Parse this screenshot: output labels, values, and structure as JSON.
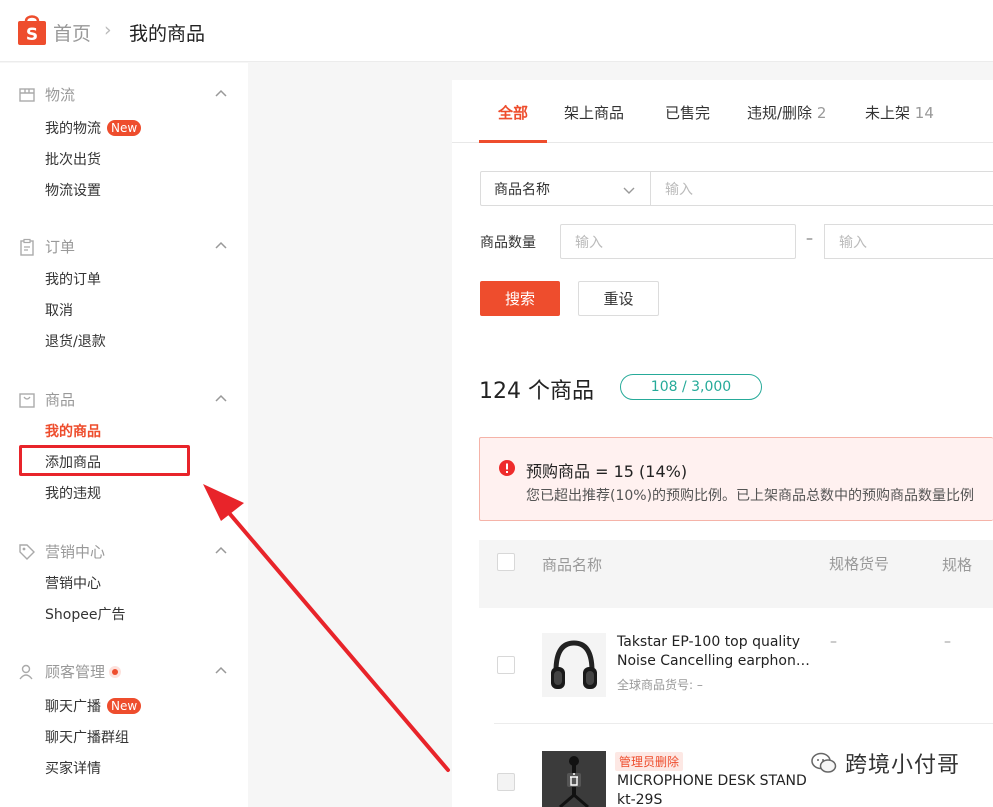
{
  "header": {
    "home": "首页",
    "separator": "›",
    "current": "我的商品"
  },
  "sidebar": {
    "groups": [
      {
        "title": "物流",
        "icon": "box-icon",
        "items": [
          {
            "label": "我的物流",
            "badge": "New"
          },
          {
            "label": "批次出货"
          },
          {
            "label": "物流设置"
          }
        ]
      },
      {
        "title": "订单",
        "icon": "clipboard-icon",
        "items": [
          {
            "label": "我的订单"
          },
          {
            "label": "取消"
          },
          {
            "label": "退货/退款"
          }
        ]
      },
      {
        "title": "商品",
        "icon": "bag-icon",
        "items": [
          {
            "label": "我的商品",
            "active": true
          },
          {
            "label": "添加商品",
            "highlighted": true
          },
          {
            "label": "我的违规"
          }
        ]
      },
      {
        "title": "营销中心",
        "icon": "tag-icon",
        "items": [
          {
            "label": "营销中心"
          },
          {
            "label": "Shopee广告"
          }
        ]
      },
      {
        "title": "顾客管理",
        "icon": "person-icon",
        "dot": true,
        "items": [
          {
            "label": "聊天广播",
            "badge": "New"
          },
          {
            "label": "聊天广播群组"
          },
          {
            "label": "买家详情"
          }
        ]
      }
    ]
  },
  "tabs": [
    {
      "label": "全部",
      "count": "",
      "active": true
    },
    {
      "label": "架上商品",
      "count": ""
    },
    {
      "label": "已售完",
      "count": ""
    },
    {
      "label": "违规/删除",
      "count": "2"
    },
    {
      "label": "未上架",
      "count": "14"
    }
  ],
  "filters": {
    "search_field_select": "商品名称",
    "search_placeholder": "输入",
    "quantity_label": "商品数量",
    "quantity_min_placeholder": "输入",
    "quantity_dash": "–",
    "quantity_max_placeholder": "输入",
    "search_button": "搜索",
    "reset_button": "重设"
  },
  "summary": {
    "count_title": "124 个商品",
    "quota": "108 / 3,000"
  },
  "alert": {
    "title": "预购商品 = 15 (14%)",
    "desc": "您已超出推荐(10%)的预购比例。已上架商品总数中的预购商品数量比例"
  },
  "table": {
    "headers": {
      "name": "商品名称",
      "spec_code": "规格货号",
      "spec": "规格"
    },
    "rows": [
      {
        "name": "Takstar EP-100 top quality Noise Cancelling earphon…",
        "sub": "全球商品货号: –",
        "spec_code": "–",
        "spec": "–"
      },
      {
        "badge": "管理员删除",
        "name": "MICROPHONE DESK STAND kt-29S"
      }
    ]
  },
  "watermark": "跨境小付哥",
  "colors": {
    "accent": "#ee4d2d",
    "quota": "#26aa99",
    "highlight": "#e8242a"
  }
}
